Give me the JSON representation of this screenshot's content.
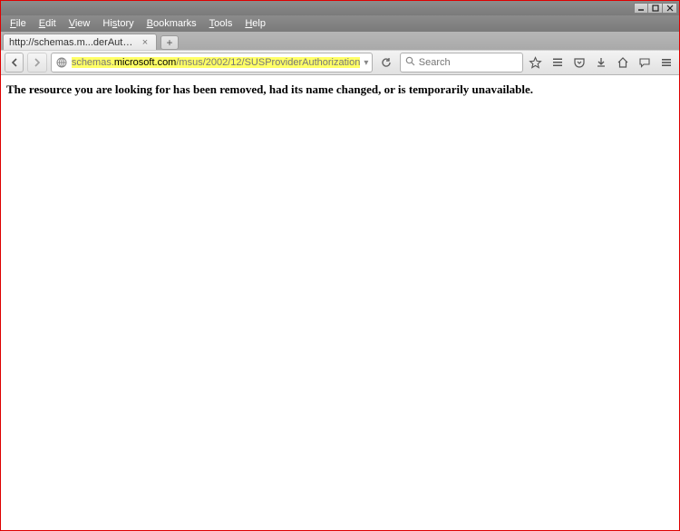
{
  "window": {
    "controls": {
      "minimize": true,
      "maximize": true,
      "close": true
    }
  },
  "menubar": {
    "items": [
      {
        "pre": "",
        "mn": "F",
        "post": "ile"
      },
      {
        "pre": "",
        "mn": "E",
        "post": "dit"
      },
      {
        "pre": "",
        "mn": "V",
        "post": "iew"
      },
      {
        "pre": "Hi",
        "mn": "s",
        "post": "tory"
      },
      {
        "pre": "",
        "mn": "B",
        "post": "ookmarks"
      },
      {
        "pre": "",
        "mn": "T",
        "post": "ools"
      },
      {
        "pre": "",
        "mn": "H",
        "post": "elp"
      }
    ]
  },
  "tabs": {
    "active": {
      "title": "http://schemas.m...derAuthorization"
    }
  },
  "nav": {
    "url_prefix": "schemas.",
    "url_domain": "microsoft.com",
    "url_path": "/msus/2002/12/SUSProviderAuthorization",
    "search_placeholder": "Search"
  },
  "page": {
    "message": "The resource you are looking for has been removed, had its name changed, or is temporarily unavailable."
  }
}
